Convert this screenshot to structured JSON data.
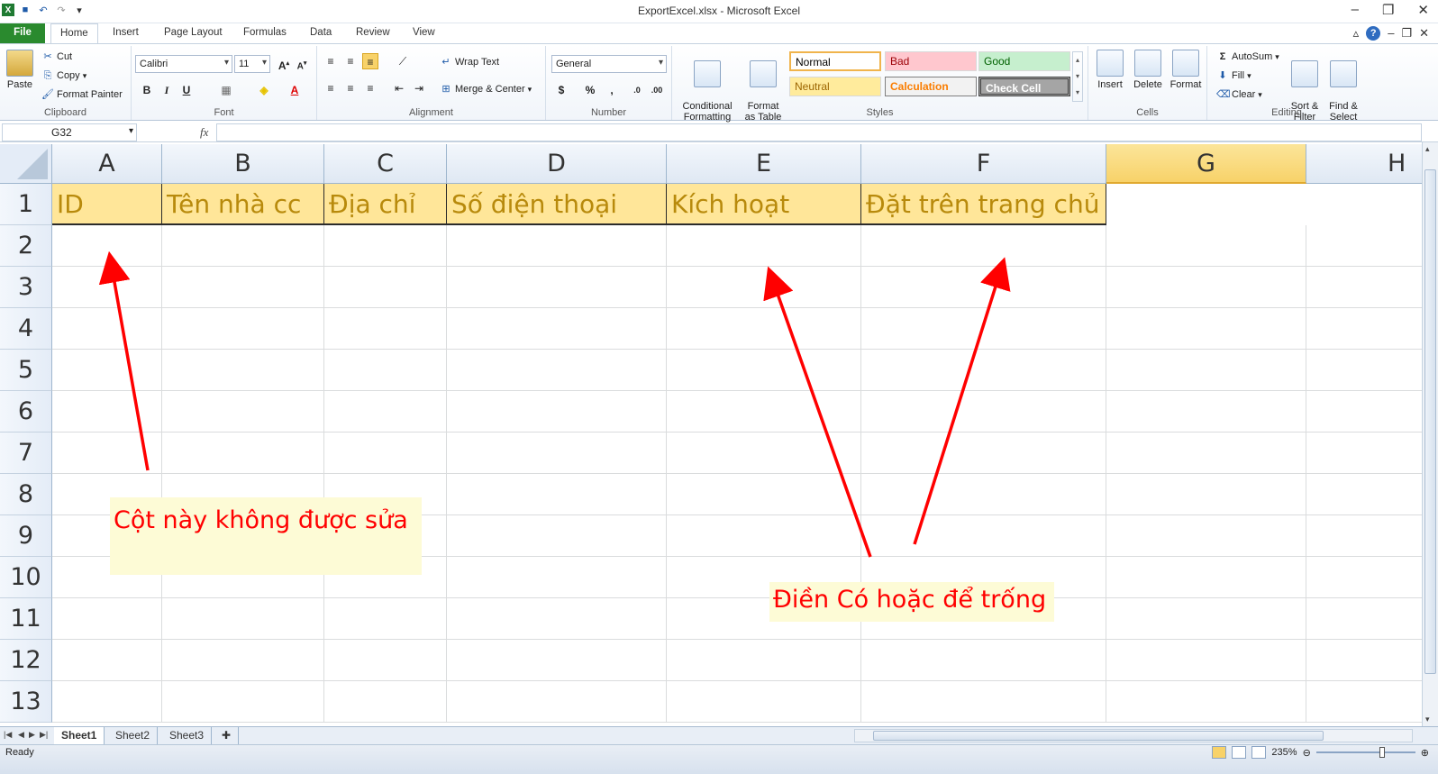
{
  "app": {
    "title": "ExportExcel.xlsx  -  Microsoft Excel"
  },
  "tabs": [
    "File",
    "Home",
    "Insert",
    "Page Layout",
    "Formulas",
    "Data",
    "Review",
    "View"
  ],
  "ribbon": {
    "clipboard": {
      "paste": "Paste",
      "cut": "Cut",
      "copy": "Copy",
      "format_painter": "Format Painter",
      "label": "Clipboard"
    },
    "font": {
      "name": "Calibri",
      "size": "11",
      "bold": "B",
      "italic": "I",
      "underline": "U",
      "label": "Font"
    },
    "alignment": {
      "wrap_text": "Wrap Text",
      "merge_center": "Merge & Center",
      "label": "Alignment"
    },
    "number": {
      "format": "General",
      "currency": "$",
      "percent": "%",
      "comma": ",",
      "label": "Number"
    },
    "styles": {
      "conditional": "Conditional\nFormatting",
      "format_table": "Format\nas Table",
      "cells": [
        "Normal",
        "Bad",
        "Good",
        "Neutral",
        "Calculation",
        "Check Cell"
      ],
      "label": "Styles"
    },
    "cells": {
      "insert": "Insert",
      "delete": "Delete",
      "format": "Format",
      "label": "Cells"
    },
    "editing": {
      "autosum": "AutoSum",
      "fill": "Fill",
      "clear": "Clear",
      "sort_filter": "Sort &\nFilter",
      "find_select": "Find &\nSelect",
      "label": "Editing"
    }
  },
  "formula_bar": {
    "name_box": "G32",
    "fx": "fx",
    "value": ""
  },
  "sheet": {
    "columns": [
      "A",
      "B",
      "C",
      "D",
      "E",
      "F",
      "G",
      "H"
    ],
    "rows": [
      "1",
      "2",
      "3",
      "4",
      "5",
      "6",
      "7",
      "8",
      "9",
      "10",
      "11",
      "12",
      "13"
    ],
    "header_row": [
      "ID",
      "Tên nhà cc",
      "Địa chỉ",
      "Số điện thoại",
      "Kích hoạt",
      "Đặt trên trang chủ"
    ]
  },
  "annotations": {
    "note_left": "Cột này không được sửa",
    "note_right": "Điền Có hoặc để trống"
  },
  "sheet_tabs": [
    "Sheet1",
    "Sheet2",
    "Sheet3"
  ],
  "status": {
    "text": "Ready",
    "zoom": "235%"
  },
  "colors": {
    "header_fill": "#ffe699",
    "header_text": "#b88a0c",
    "annotation": "#ff0000",
    "selected_col": "#f8d269"
  }
}
